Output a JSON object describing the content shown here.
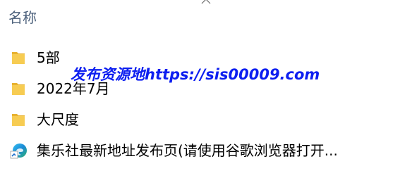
{
  "header": {
    "column_name": "名称"
  },
  "files": [
    {
      "name": "5部",
      "icon": "folder-icon"
    },
    {
      "name": "2022年7月",
      "icon": "folder-icon"
    },
    {
      "name": "大尺度",
      "icon": "folder-icon"
    },
    {
      "name": "集乐社最新地址发布页(请使用谷歌浏览器打开...",
      "icon": "edge-html-file-icon"
    }
  ],
  "watermark": {
    "text": "发布资源地https://sis00009.com"
  },
  "colors": {
    "header_text": "#4a5f7a",
    "folder_yellow": "#f5c342",
    "watermark_blue": "#0d1ff0"
  }
}
